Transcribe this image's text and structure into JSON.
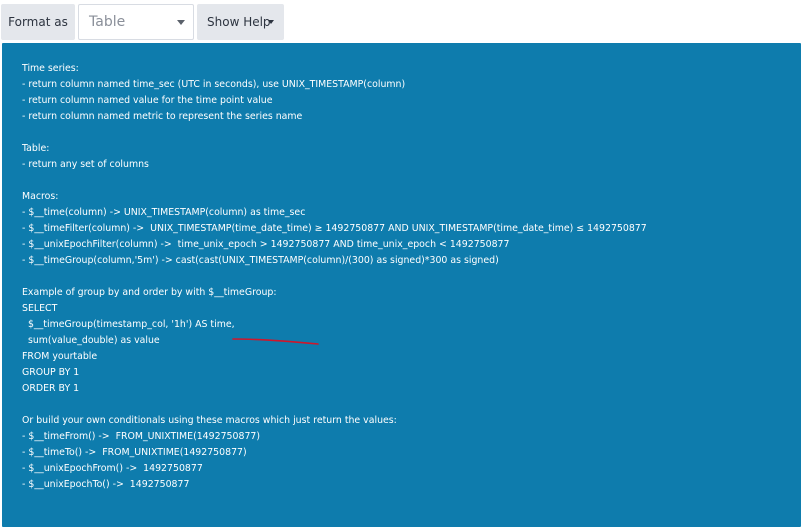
{
  "toolbar": {
    "format_label": "Format as",
    "format_value": "Table",
    "help_button": "Show Help"
  },
  "help": {
    "lines": [
      "Time series:",
      "- return column named time_sec (UTC in seconds), use UNIX_TIMESTAMP(column)",
      "- return column named value for the time point value",
      "- return column named metric to represent the series name",
      "Table:",
      "- return any set of columns",
      "Macros:",
      "- $__time(column) -> UNIX_TIMESTAMP(column) as time_sec",
      "- $__timeFilter(column) ->  UNIX_TIMESTAMP(time_date_time) ≥ 1492750877 AND UNIX_TIMESTAMP(time_date_time) ≤ 1492750877",
      "- $__unixEpochFilter(column) ->  time_unix_epoch > 1492750877 AND time_unix_epoch < 1492750877",
      "- $__timeGroup(column,'5m') -> cast(cast(UNIX_TIMESTAMP(column)/(300) as signed)*300 as signed)",
      "Example of group by and order by with $__timeGroup:",
      "SELECT",
      "  $__timeGroup(timestamp_col, '1h') AS time,",
      "  sum(value_double) as value",
      "FROM yourtable",
      "GROUP BY 1",
      "ORDER BY 1",
      "Or build your own conditionals using these macros which just return the values:",
      "- $__timeFrom() ->  FROM_UNIXTIME(1492750877)",
      "- $__timeTo() ->  FROM_UNIXTIME(1492750877)",
      "- $__unixEpochFrom() ->  1492750877",
      "- $__unixEpochTo() ->  1492750877"
    ]
  },
  "colors": {
    "panel_background": "#0e7cad",
    "panel_text": "#ffffff",
    "annotation_stroke": "#d0162b"
  }
}
